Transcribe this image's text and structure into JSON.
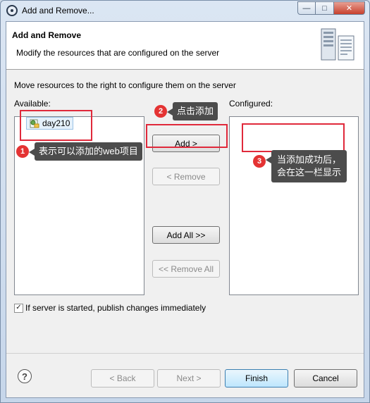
{
  "window": {
    "title": "Add and Remove...",
    "buttons": {
      "minimize": "—",
      "maximize": "□",
      "close": "✕"
    }
  },
  "header": {
    "title": "Add and Remove",
    "description": "Modify the resources that are configured on the server"
  },
  "instruction": "Move resources to the right to configure them on the server",
  "available": {
    "label": "Available:",
    "items": [
      "day210"
    ]
  },
  "configured": {
    "label": "Configured:",
    "items": []
  },
  "buttons": {
    "add": "Add >",
    "remove": "< Remove",
    "add_all": "Add All >>",
    "remove_all": "<< Remove All"
  },
  "publish_checkbox": {
    "label": "If server is started, publish changes immediately",
    "checked": true
  },
  "footer": {
    "help": "?",
    "back": "< Back",
    "next": "Next >",
    "finish": "Finish",
    "cancel": "Cancel"
  },
  "annotations": {
    "one": {
      "number": "1",
      "text": "表示可以添加的web项目"
    },
    "two": {
      "number": "2",
      "text": "点击添加"
    },
    "three": {
      "number": "3",
      "line1": "当添加成功后，",
      "line2": "会在这一栏显示"
    }
  },
  "colors": {
    "annotation_red": "#e0293b",
    "callout_bg": "#4c4c4c",
    "number_badge": "#e43333"
  }
}
